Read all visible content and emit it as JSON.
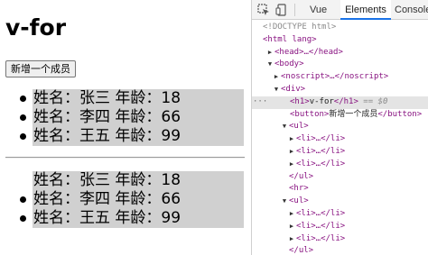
{
  "page": {
    "heading": "v-for",
    "add_button": "新增一个成员",
    "list1": [
      "姓名：张三 年龄：18",
      "姓名：李四 年龄：66",
      "姓名：王五 年龄：99"
    ],
    "list2": [
      "姓名：张三 年龄：18",
      "姓名：李四 年龄：66",
      "姓名：王五 年龄：99"
    ]
  },
  "devtools": {
    "tabs": {
      "vue": "Vue",
      "elements": "Elements",
      "console": "Console"
    },
    "tree": {
      "doctype": "<!DOCTYPE html>",
      "html_open": "<html lang>",
      "head": "<head>…</head>",
      "body_open": "<body>",
      "noscript": "<noscript>…</noscript>",
      "div_open": "<div>",
      "h1_open": "<h1>",
      "h1_text": "v-for",
      "h1_close": "</h1>",
      "h1_eq": "== $0",
      "button_open": "<button>",
      "button_text": "新增一个成员",
      "button_close": "</button>",
      "ul1_open": "<ul>",
      "li_collapsed": "<li>…</li>",
      "ul_close": "</ul>",
      "hr": "<hr>",
      "ul2_open": "<ul>"
    },
    "selected_row": "h1",
    "colors": {
      "tag": "#881280",
      "selected_bg": "#e4e4e4",
      "accent": "#1a73e8"
    }
  }
}
